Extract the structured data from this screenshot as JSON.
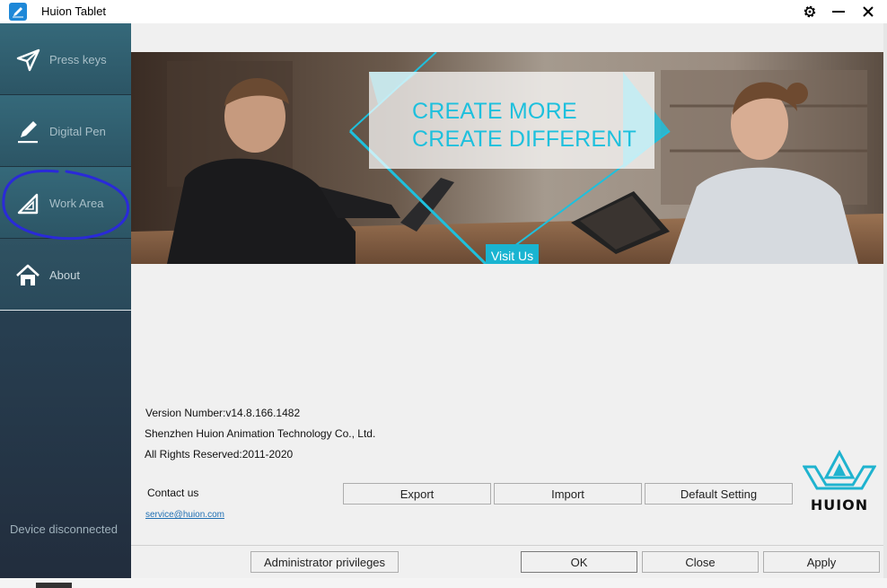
{
  "window": {
    "title": "Huion Tablet",
    "controls": {
      "settings_icon": "gear-icon",
      "minimize": "—",
      "close": "X"
    }
  },
  "sidebar": {
    "items": [
      {
        "label": "Press keys",
        "icon": "send-icon"
      },
      {
        "label": "Digital Pen",
        "icon": "pen-icon"
      },
      {
        "label": "Work Area",
        "icon": "set-square-icon"
      },
      {
        "label": "About",
        "icon": "home-icon"
      }
    ],
    "device_status": "Device disconnected"
  },
  "banner": {
    "line1": "CREATE MORE",
    "line2": "CREATE DIFFERENT",
    "visit_label": "Visit Us",
    "accent_color": "#1ec0dd"
  },
  "info": {
    "version": "Version Number:v14.8.166.1482",
    "company": "Shenzhen Huion Animation Technology Co., Ltd.",
    "rights": "All Rights Reserved:2011-2020"
  },
  "contact": {
    "label": "Contact us",
    "email": "service@huion.com"
  },
  "actions": {
    "export": "Export",
    "import": "Import",
    "default": "Default Setting"
  },
  "logo_text": "HUION",
  "footer": {
    "admin": "Administrator privileges",
    "ok": "OK",
    "close": "Close",
    "apply": "Apply"
  }
}
